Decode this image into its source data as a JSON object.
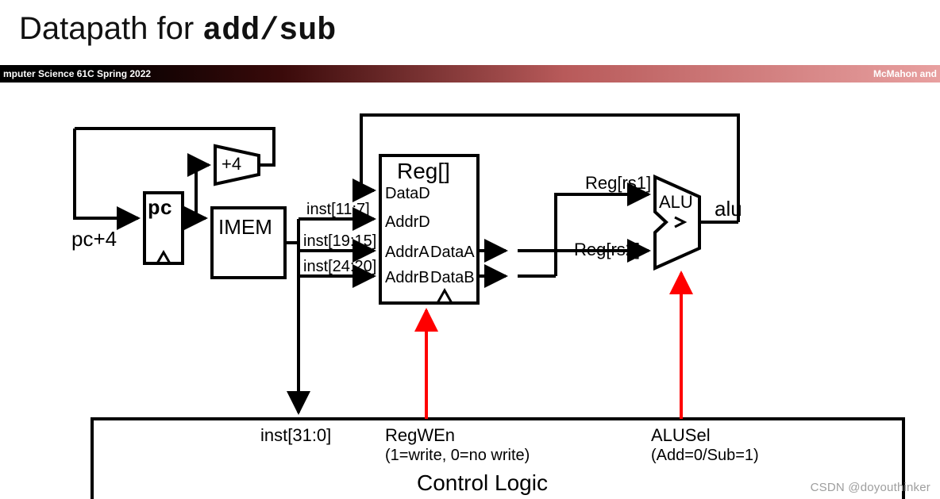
{
  "title_prefix": "Datapath for ",
  "title_code": "add/sub",
  "band": {
    "left": "mputer Science 61C Spring 2022",
    "right": "McMahon and"
  },
  "labels": {
    "pc_plus_4": "pc+4",
    "pc": "pc",
    "plus4": "+4",
    "imem": "IMEM",
    "reg_block": "Reg[]",
    "dataD": "DataD",
    "addrD": "AddrD",
    "addrA": "AddrA",
    "dataA": "DataA",
    "addrB": "AddrB",
    "dataB": "DataB",
    "inst_11_7": "inst[11:7]",
    "inst_19_15": "inst[19:15]",
    "inst_24_20": "inst[24:20]",
    "reg_rs1": "Reg[rs1]",
    "reg_rs2": "Reg[rs2]",
    "alu": "ALU",
    "alu_out": "alu",
    "inst_full": "inst[31:0]",
    "regwen": "RegWEn",
    "regwen_sub": "(1=write, 0=no write)",
    "alusel": "ALUSel",
    "alusel_sub": "(Add=0/Sub=1)",
    "control_logic": "Control Logic"
  },
  "watermark": "CSDN @doyouthinker"
}
